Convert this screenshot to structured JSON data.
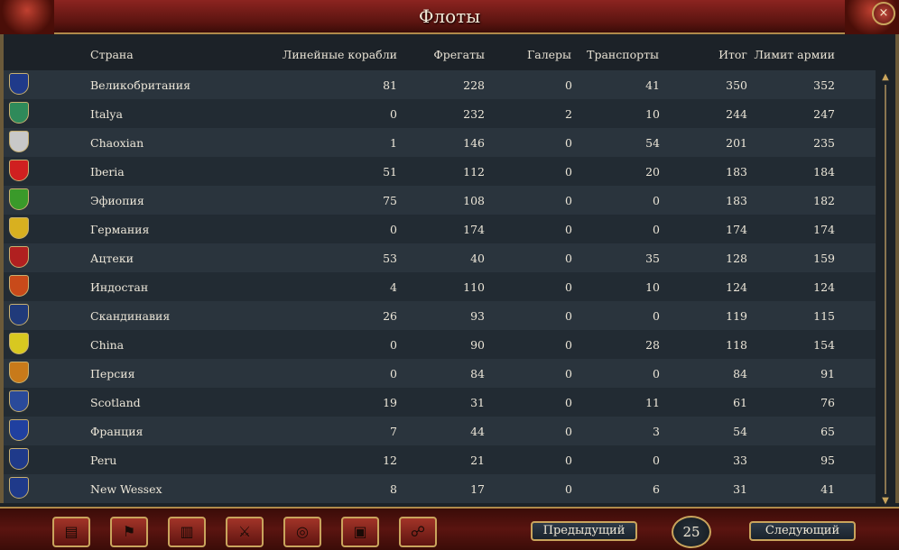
{
  "window": {
    "title": "Флоты",
    "close_icon": "×"
  },
  "columns": {
    "country": "Страна",
    "ships_of_line": "Линейные корабли",
    "frigates": "Фрегаты",
    "galleys": "Галеры",
    "transports": "Транспорты",
    "total": "Итог",
    "limit": "Лимит армии"
  },
  "rows": [
    {
      "country": "Великобритания",
      "ships_of_line": "81",
      "frigates": "228",
      "galleys": "0",
      "transports": "41",
      "total": "350",
      "limit": "352",
      "flag_color": "#1f3a8a"
    },
    {
      "country": "Italya",
      "ships_of_line": "0",
      "frigates": "232",
      "galleys": "2",
      "transports": "10",
      "total": "244",
      "limit": "247",
      "flag_color": "#2f8a5a"
    },
    {
      "country": "Chaoxian",
      "ships_of_line": "1",
      "frigates": "146",
      "galleys": "0",
      "transports": "54",
      "total": "201",
      "limit": "235",
      "flag_color": "#c8c8c8"
    },
    {
      "country": "Iberia",
      "ships_of_line": "51",
      "frigates": "112",
      "galleys": "0",
      "transports": "20",
      "total": "183",
      "limit": "184",
      "flag_color": "#d02020"
    },
    {
      "country": "Эфиопия",
      "ships_of_line": "75",
      "frigates": "108",
      "galleys": "0",
      "transports": "0",
      "total": "183",
      "limit": "182",
      "flag_color": "#3a9a2a"
    },
    {
      "country": "Германия",
      "ships_of_line": "0",
      "frigates": "174",
      "galleys": "0",
      "transports": "0",
      "total": "174",
      "limit": "174",
      "flag_color": "#d8b020"
    },
    {
      "country": "Ацтеки",
      "ships_of_line": "53",
      "frigates": "40",
      "galleys": "0",
      "transports": "35",
      "total": "128",
      "limit": "159",
      "flag_color": "#b02020"
    },
    {
      "country": "Индостан",
      "ships_of_line": "4",
      "frigates": "110",
      "galleys": "0",
      "transports": "10",
      "total": "124",
      "limit": "124",
      "flag_color": "#c84a1a"
    },
    {
      "country": "Скандинавия",
      "ships_of_line": "26",
      "frigates": "93",
      "galleys": "0",
      "transports": "0",
      "total": "119",
      "limit": "115",
      "flag_color": "#203a7a"
    },
    {
      "country": "China",
      "ships_of_line": "0",
      "frigates": "90",
      "galleys": "0",
      "transports": "28",
      "total": "118",
      "limit": "154",
      "flag_color": "#d8c820"
    },
    {
      "country": "Персия",
      "ships_of_line": "0",
      "frigates": "84",
      "galleys": "0",
      "transports": "0",
      "total": "84",
      "limit": "91",
      "flag_color": "#c87a1a"
    },
    {
      "country": "Scotland",
      "ships_of_line": "19",
      "frigates": "31",
      "galleys": "0",
      "transports": "11",
      "total": "61",
      "limit": "76",
      "flag_color": "#2a4a9a"
    },
    {
      "country": "Франция",
      "ships_of_line": "7",
      "frigates": "44",
      "galleys": "0",
      "transports": "3",
      "total": "54",
      "limit": "65",
      "flag_color": "#2040a0"
    },
    {
      "country": "Peru",
      "ships_of_line": "12",
      "frigates": "21",
      "galleys": "0",
      "transports": "0",
      "total": "33",
      "limit": "95",
      "flag_color": "#1f3a8a"
    },
    {
      "country": "New Wessex",
      "ships_of_line": "8",
      "frigates": "17",
      "galleys": "0",
      "transports": "6",
      "total": "31",
      "limit": "41",
      "flag_color": "#1f3a8a"
    }
  ],
  "toolbar": {
    "buttons": [
      {
        "icon": "ledger-icon",
        "glyph": "▤"
      },
      {
        "icon": "flag-icon",
        "glyph": "⚑"
      },
      {
        "icon": "buildings-icon",
        "glyph": "▥"
      },
      {
        "icon": "crossed-swords-icon",
        "glyph": "⚔"
      },
      {
        "icon": "coins-icon",
        "glyph": "◎"
      },
      {
        "icon": "crate-icon",
        "glyph": "▣"
      },
      {
        "icon": "handshake-icon",
        "glyph": "☍"
      }
    ]
  },
  "pagination": {
    "prev_label": "Предыдущий",
    "page": "25",
    "next_label": "Следующий"
  },
  "scrollbar": {
    "up_icon": "▲",
    "down_icon": "▼"
  },
  "colors": {
    "frame_red": "#8c2420",
    "gold": "#c9a45c",
    "row_even": "#2a343d",
    "row_odd": "#222b33"
  }
}
